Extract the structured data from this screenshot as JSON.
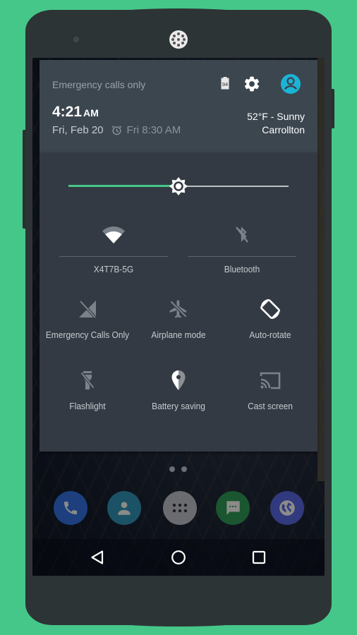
{
  "device": {
    "background_color": "#46c78a",
    "body_color": "#2d3435"
  },
  "quick_settings": {
    "header": {
      "carrier_text": "Emergency calls only",
      "time": "4:21",
      "ampm": "AM",
      "date": "Fri, Feb 20",
      "alarm": "Fri 8:30 AM",
      "weather_line1": "52°F - Sunny",
      "weather_line2": "Carrollton",
      "battery_level": "94",
      "icons": {
        "battery": "battery-icon",
        "settings": "gear-icon",
        "user": "account-circle-icon"
      },
      "accent_color": "#1ab5d6"
    },
    "brightness": {
      "level_percent": 50,
      "fill_color": "#46c78a"
    },
    "tiles_top": [
      {
        "label": "X4T7B-5G",
        "icon": "wifi-icon",
        "active": true
      },
      {
        "label": "Bluetooth",
        "icon": "bluetooth-disabled-icon",
        "active": false
      }
    ],
    "tiles": [
      {
        "label": "Emergency Calls Only",
        "icon": "signal-off-icon",
        "active": false
      },
      {
        "label": "Airplane mode",
        "icon": "airplane-off-icon",
        "active": false
      },
      {
        "label": "Auto-rotate",
        "icon": "screen-rotation-icon",
        "active": true
      },
      {
        "label": "Flashlight",
        "icon": "flashlight-off-icon",
        "active": false
      },
      {
        "label": "Battery saving",
        "icon": "location-half-icon",
        "active": true
      },
      {
        "label": "Cast screen",
        "icon": "cast-icon",
        "active": false
      }
    ]
  },
  "home": {
    "page_count": 2,
    "dock": [
      {
        "name": "Phone",
        "icon": "phone-icon",
        "color": "#1d3f7d"
      },
      {
        "name": "Contacts",
        "icon": "person-icon",
        "color": "#1c5266"
      },
      {
        "name": "Apps",
        "icon": "app-drawer-icon",
        "color": "#6a6c70"
      },
      {
        "name": "Messenger",
        "icon": "message-icon",
        "color": "#1a5630"
      },
      {
        "name": "Browser",
        "icon": "globe-icon",
        "color": "#313a7e"
      }
    ]
  },
  "navbar": {
    "back": "back-icon",
    "home": "home-icon",
    "recents": "recents-icon"
  }
}
